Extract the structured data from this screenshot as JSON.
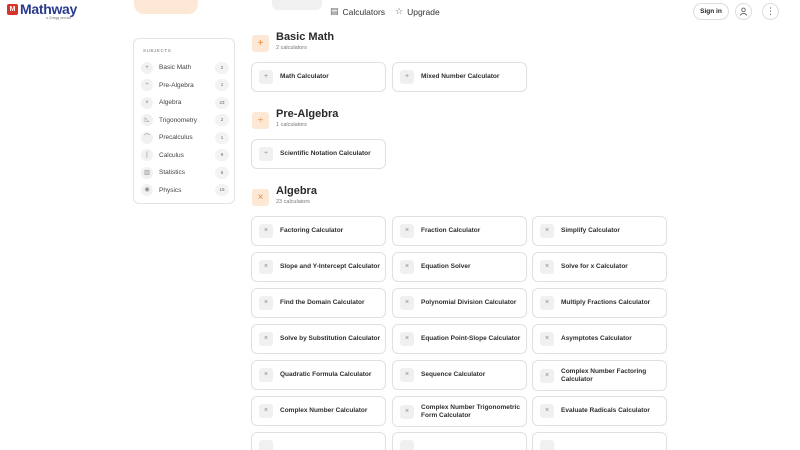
{
  "header": {
    "logo_badge": "M",
    "logo_text": "Mathway",
    "logo_sub": "a Chegg service",
    "nav": [
      {
        "label": "Calculators",
        "icon": "calculator-icon"
      },
      {
        "label": "Upgrade",
        "icon": "star-icon"
      }
    ],
    "sign_in": "Sign in"
  },
  "sidebar": {
    "title": "SUBJECTS",
    "items": [
      {
        "label": "Basic Math",
        "count": "2",
        "icon": "+"
      },
      {
        "label": "Pre-Algebra",
        "count": "1",
        "icon": "÷"
      },
      {
        "label": "Algebra",
        "count": "23",
        "icon": "×"
      },
      {
        "label": "Trigonometry",
        "count": "2",
        "icon": "◺"
      },
      {
        "label": "Precalculus",
        "count": "1",
        "icon": "⌒"
      },
      {
        "label": "Calculus",
        "count": "9",
        "icon": "∫"
      },
      {
        "label": "Statistics",
        "count": "6",
        "icon": "▥"
      },
      {
        "label": "Physics",
        "count": "15",
        "icon": "◉"
      }
    ]
  },
  "sections": [
    {
      "title": "Basic Math",
      "count": "2 calculators",
      "icon": "+",
      "cards": [
        {
          "label": "Math Calculator",
          "icon": "+"
        },
        {
          "label": "Mixed Number Calculator",
          "icon": "+"
        }
      ]
    },
    {
      "title": "Pre-Algebra",
      "count": "1 calculators",
      "icon": "÷",
      "cards": [
        {
          "label": "Scientific Notation Calculator",
          "icon": "÷"
        }
      ]
    },
    {
      "title": "Algebra",
      "count": "23 calculators",
      "icon": "×",
      "cards": [
        {
          "label": "Factoring Calculator",
          "icon": "×"
        },
        {
          "label": "Fraction Calculator",
          "icon": "×"
        },
        {
          "label": "Simplify Calculator",
          "icon": "×"
        },
        {
          "label": "Slope and Y-Intercept Calculator",
          "icon": "×"
        },
        {
          "label": "Equation Solver",
          "icon": "×"
        },
        {
          "label": "Solve for x Calculator",
          "icon": "×"
        },
        {
          "label": "Find the Domain Calculator",
          "icon": "×"
        },
        {
          "label": "Polynomial Division Calculator",
          "icon": "×"
        },
        {
          "label": "Multiply Fractions Calculator",
          "icon": "×"
        },
        {
          "label": "Solve by Substitution Calculator",
          "icon": "×"
        },
        {
          "label": "Equation Point-Slope Calculator",
          "icon": "×"
        },
        {
          "label": "Asymptotes Calculator",
          "icon": "×"
        },
        {
          "label": "Quadratic Formula Calculator",
          "icon": "×"
        },
        {
          "label": "Sequence Calculator",
          "icon": "×"
        },
        {
          "label": "Complex Number Factoring Calculator",
          "icon": "×"
        },
        {
          "label": "Complex Number Calculator",
          "icon": "×"
        },
        {
          "label": "Complex Number Trigonometric Form Calculator",
          "icon": "×"
        },
        {
          "label": "Evaluate Radicals Calculator",
          "icon": "×"
        },
        {
          "label": "",
          "icon": ""
        },
        {
          "label": "",
          "icon": ""
        },
        {
          "label": "",
          "icon": ""
        }
      ]
    }
  ],
  "colors": {
    "accent_bg": "#fde8d6",
    "accent_fg": "#e08a3c",
    "logo_blue": "#2a3b8f",
    "logo_red": "#d6332a"
  }
}
